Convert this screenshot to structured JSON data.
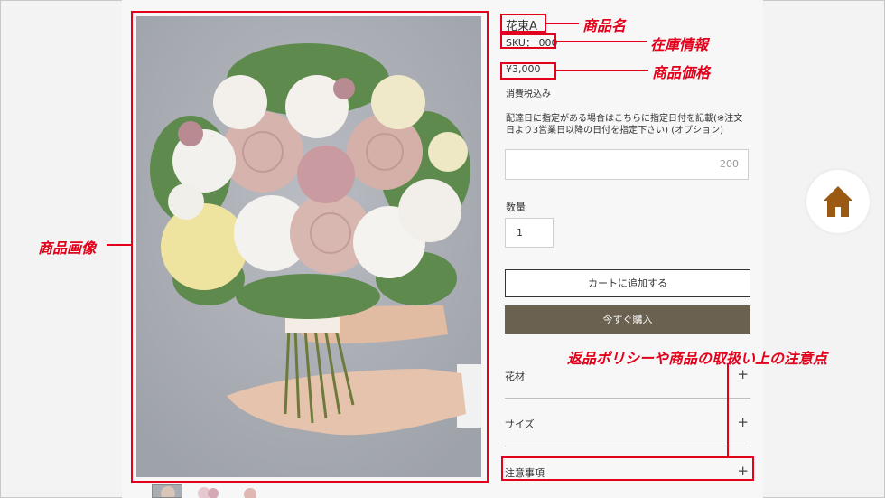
{
  "product": {
    "name": "花束A",
    "sku_label": "SKU： 000",
    "price": "¥3,000",
    "tax_note": "消費税込み",
    "delivery_label": "配達日に指定がある場合はこちらに指定日付を記載(※注文日より3営業日以降の日付を指定下さい) (オプション)",
    "delivery_counter": "200",
    "quantity_label": "数量",
    "quantity_value": "1",
    "add_to_cart": "カートに追加する",
    "buy_now": "今すぐ購入"
  },
  "accordions": [
    {
      "label": "花材",
      "icon": "+"
    },
    {
      "label": "サイズ",
      "icon": "+"
    },
    {
      "label": "注意事項",
      "icon": "+"
    }
  ],
  "annotations": {
    "name": "商品名",
    "stock": "在庫情報",
    "price": "商品価格",
    "image": "商品画像",
    "policy": "返品ポリシーや商品の取扱い上の注意点"
  },
  "colors": {
    "annotation": "#e3001b",
    "buy_button": "#6b6150",
    "home_icon": "#9a5a12"
  },
  "icons": {
    "home": "home-icon",
    "expand": "plus-icon"
  }
}
